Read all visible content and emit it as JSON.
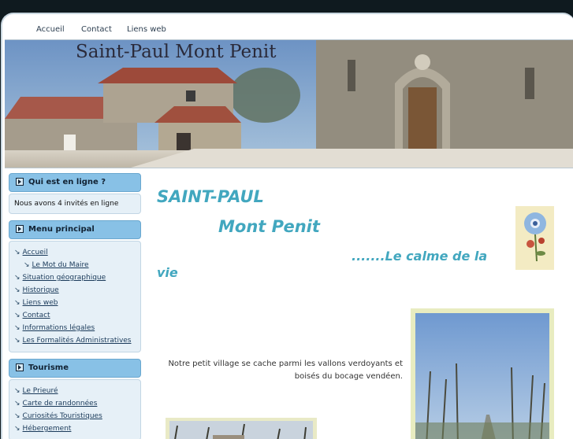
{
  "topnav": {
    "items": [
      {
        "label": "Accueil"
      },
      {
        "label": "Contact"
      },
      {
        "label": "Liens web"
      }
    ]
  },
  "header": {
    "site_title": "Saint-Paul Mont Penit"
  },
  "sidebar": {
    "online": {
      "title": "Qui est en ligne ?",
      "text": "Nous avons 4 invités en ligne"
    },
    "main_menu": {
      "title": "Menu principal",
      "items": [
        {
          "label": "Accueil"
        },
        {
          "label": "Le Mot du Maire",
          "sub": true
        },
        {
          "label": "Situation géographique"
        },
        {
          "label": "Historique"
        },
        {
          "label": "Liens web"
        },
        {
          "label": "Contact"
        },
        {
          "label": "Informations légales"
        },
        {
          "label": "Les Formalités Administratives"
        }
      ]
    },
    "tourisme": {
      "title": "Tourisme",
      "items": [
        {
          "label": "Le Prieuré"
        },
        {
          "label": "Carte de randonnées"
        },
        {
          "label": "Curiosités Touristiques"
        },
        {
          "label": "Hébergement"
        }
      ]
    }
  },
  "content": {
    "heading_1": "SAINT-PAUL",
    "heading_2": "Mont Penit",
    "heading_3": ".......Le calme de la",
    "heading_4": "vie",
    "intro": "Notre petit village se cache parmi les vallons verdoyants et boisés du bocage vendéen."
  }
}
